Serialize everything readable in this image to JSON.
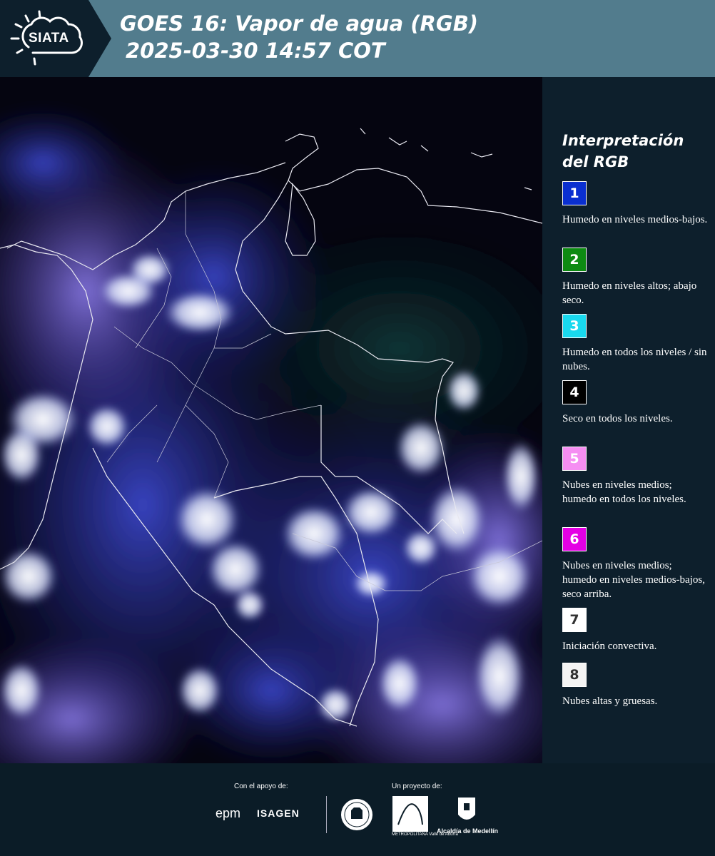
{
  "header": {
    "logo_text": "SIATA",
    "title_line1": "GOES 16: Vapor de agua (RGB)",
    "title_line2": "2025-03-30 14:57 COT"
  },
  "legend": {
    "title": "Interpretación del RGB",
    "items": [
      {
        "number": "1",
        "color": "#0a2fd0",
        "text_color": "#ffffff",
        "description": "Humedo en niveles medios-bajos."
      },
      {
        "number": "2",
        "color": "#0d8a12",
        "text_color": "#ffffff",
        "description": "Humedo en niveles altos; abajo seco."
      },
      {
        "number": "3",
        "color": "#19d9ee",
        "text_color": "#ffffff",
        "description": "Humedo en todos los niveles / sin nubes."
      },
      {
        "number": "4",
        "color": "#000000",
        "text_color": "#ffffff",
        "description": "Seco en todos los niveles."
      },
      {
        "number": "5",
        "color": "#f58ef2",
        "text_color": "#ffffff",
        "description": "Nubes en niveles medios; humedo en todos los niveles."
      },
      {
        "number": "6",
        "color": "#e400e4",
        "text_color": "#ffffff",
        "description": "Nubes en niveles medios; humedo en niveles medios-bajos, seco arriba."
      },
      {
        "number": "7",
        "color": "#ffffff",
        "text_color": "#333333",
        "description": "Iniciación convectiva."
      },
      {
        "number": "8",
        "color": "#f4f4f4",
        "text_color": "#333333",
        "description": "Nubes altas y gruesas."
      }
    ]
  },
  "footer": {
    "support_label": "Con el apoyo de:",
    "project_label": "Un proyecto de:",
    "sponsor1": "epm",
    "sponsor2": "ISAGEN",
    "partner1": "METROPOLITANA Valle de Aburrá",
    "partner2": "Alcaldía de Medellín"
  }
}
